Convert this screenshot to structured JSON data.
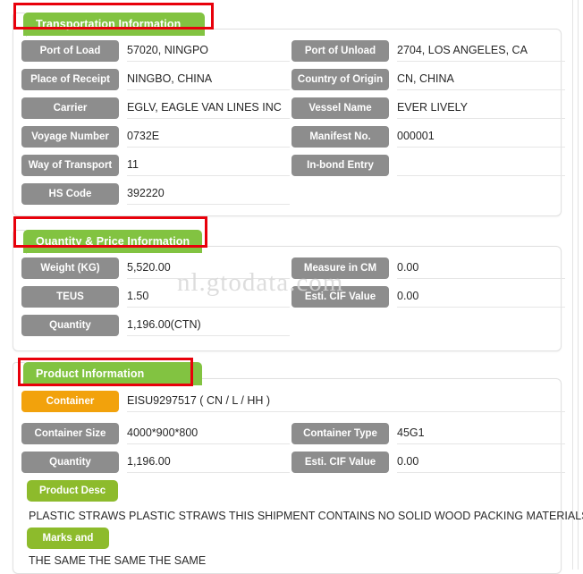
{
  "watermark": "nl.gtodata.com",
  "sections": [
    {
      "id": "transportation",
      "title": "Transportation Information",
      "left_fields": [
        {
          "label": "Port of Load",
          "value": "57020, NINGPO"
        },
        {
          "label": "Place of Receipt",
          "value": "NINGBO, CHINA"
        },
        {
          "label": "Carrier",
          "value": "EGLV, EAGLE VAN LINES INC"
        },
        {
          "label": "Voyage Number",
          "value": "0732E"
        },
        {
          "label": "Way of Transport",
          "value": "11"
        },
        {
          "label": "HS Code",
          "value": "392220"
        }
      ],
      "right_fields": [
        {
          "label": "Port of Unload",
          "value": "2704, LOS ANGELES, CA"
        },
        {
          "label": "Country of Origin",
          "value": "CN, CHINA"
        },
        {
          "label": "Vessel Name",
          "value": "EVER LIVELY"
        },
        {
          "label": "Manifest No.",
          "value": "000001"
        },
        {
          "label": "In-bond Entry",
          "value": ""
        }
      ]
    },
    {
      "id": "quantity-price",
      "title": "Quantity & Price Information",
      "left_fields": [
        {
          "label": "Weight (KG)",
          "value": "5,520.00"
        },
        {
          "label": "TEUS",
          "value": "1.50"
        },
        {
          "label": "Quantity",
          "value": "1,196.00(CTN)"
        }
      ],
      "right_fields": [
        {
          "label": "Measure in CM",
          "value": "0.00"
        },
        {
          "label": "Esti. CIF Value",
          "value": "0.00"
        }
      ]
    },
    {
      "id": "product",
      "title": "Product Information",
      "container_field": {
        "label": "Container",
        "value": "EISU9297517 ( CN / L / HH )"
      },
      "left_fields": [
        {
          "label": "Container Size",
          "value": "4000*900*800"
        },
        {
          "label": "Quantity",
          "value": "1,196.00"
        }
      ],
      "right_fields": [
        {
          "label": "Container Type",
          "value": "45G1"
        },
        {
          "label": "Esti. CIF Value",
          "value": "0.00"
        }
      ],
      "product_desc": {
        "label": "Product Desc",
        "text": "PLASTIC STRAWS PLASTIC STRAWS THIS SHIPMENT CONTAINS NO SOLID WOOD PACKING MATERIALS."
      },
      "marks": {
        "label": "Marks and",
        "text": "THE SAME THE SAME THE SAME"
      }
    }
  ],
  "colors": {
    "tab_green": "#82c341",
    "pill_green": "#8dbb2c",
    "label_gray": "#8d8d8d",
    "container_orange": "#f2a20c",
    "annotation_red": "#e8000b"
  }
}
